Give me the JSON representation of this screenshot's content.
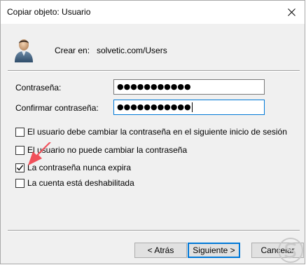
{
  "window": {
    "title": "Copiar objeto: Usuario"
  },
  "header": {
    "crear_label": "Crear en:",
    "crear_value": "solvetic.com/Users"
  },
  "fields": {
    "password_label": "Contraseña:",
    "password_value": "●●●●●●●●●●●",
    "confirm_label": "Confirmar contraseña:",
    "confirm_value": "●●●●●●●●●●●"
  },
  "options": [
    {
      "label": "El usuario debe cambiar la contraseña en el siguiente inicio de sesión",
      "checked": false
    },
    {
      "label": "El usuario no puede cambiar la contraseña",
      "checked": false
    },
    {
      "label": "La contraseña nunca expira",
      "checked": true
    },
    {
      "label": "La cuenta está deshabilitada",
      "checked": false
    }
  ],
  "buttons": {
    "back": "< Atrás",
    "next": "Siguiente >",
    "cancel": "Cancelar"
  },
  "colors": {
    "accent": "#0078d7",
    "annotation_arrow": "#f0505a"
  },
  "icons": {
    "close": "close-icon",
    "user": "user-icon",
    "arrow": "arrow-annotation-icon",
    "watermark": "solvetic-logo"
  }
}
